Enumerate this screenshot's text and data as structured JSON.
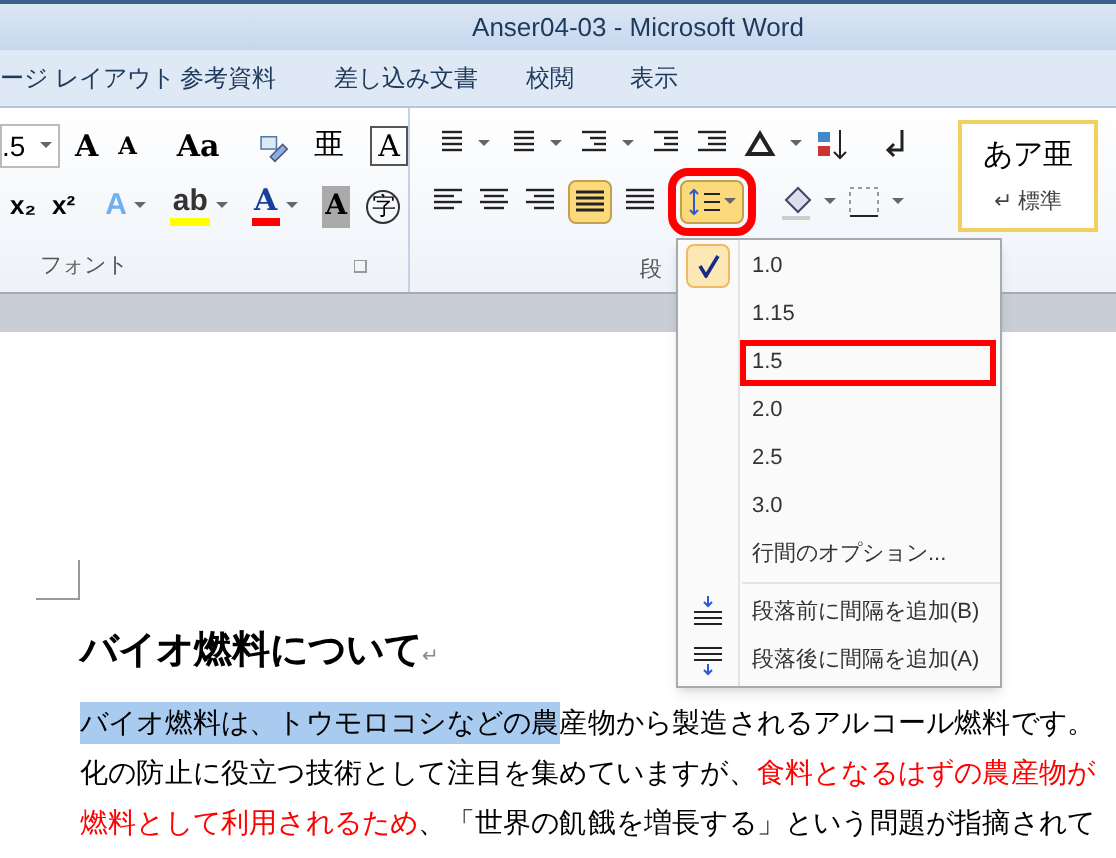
{
  "window": {
    "title": "Anser04-03 - Microsoft Word"
  },
  "tabs": [
    {
      "label": "ージ レイアウト",
      "selected": false
    },
    {
      "label": "参考資料",
      "selected": false
    },
    {
      "label": "差し込み文書",
      "selected": false
    },
    {
      "label": "校閲",
      "selected": false
    },
    {
      "label": "表示",
      "selected": false
    }
  ],
  "font_group": {
    "size": ".5",
    "row1": [
      "A",
      "A",
      "Aa"
    ],
    "row1b": [
      "亜",
      "A"
    ],
    "row2": [
      "x₂",
      "x²"
    ],
    "row2b": [
      "A",
      "ab",
      "A"
    ],
    "shade": "A",
    "enclose": "字",
    "label": "フォント"
  },
  "paragraph_group": {
    "label": "段",
    "justify_on": true,
    "line_spacing_open": true
  },
  "styles": {
    "preview": "あア亜",
    "name": "↵ 標準",
    "selected": true
  },
  "line_spacing_menu": {
    "items": [
      {
        "kind": "value",
        "label": "1.0",
        "checked": true,
        "highlighted": false
      },
      {
        "kind": "value",
        "label": "1.15",
        "checked": false,
        "highlighted": false
      },
      {
        "kind": "value",
        "label": "1.5",
        "checked": false,
        "highlighted": true
      },
      {
        "kind": "value",
        "label": "2.0",
        "checked": false,
        "highlighted": false
      },
      {
        "kind": "value",
        "label": "2.5",
        "checked": false,
        "highlighted": false
      },
      {
        "kind": "value",
        "label": "3.0",
        "checked": false,
        "highlighted": false
      },
      {
        "kind": "option",
        "label": "行間のオプション..."
      },
      {
        "kind": "add_before",
        "label": "段落前に間隔を追加(B)"
      },
      {
        "kind": "add_after",
        "label": "段落後に間隔を追加(A)"
      }
    ]
  },
  "document": {
    "heading": "バイオ燃料について",
    "mark": "↵",
    "lines": [
      [
        {
          "text": "バイオ燃料は、トウモロコシなどの農",
          "red": false,
          "selected": true
        },
        {
          "text": "産物から製造されるアルコール燃料です。",
          "red": false,
          "selected": false
        }
      ],
      [
        {
          "text": "化の防止に役立つ技術として注目を集めていますが、",
          "red": false,
          "selected": false
        },
        {
          "text": "食料となるはずの農産物が",
          "red": true,
          "selected": false
        }
      ],
      [
        {
          "text": "燃料として利用されるため",
          "red": true,
          "selected": false
        },
        {
          "text": "、「世界の飢餓を増長する」という問題が指摘されて",
          "red": false,
          "selected": false
        }
      ]
    ]
  }
}
